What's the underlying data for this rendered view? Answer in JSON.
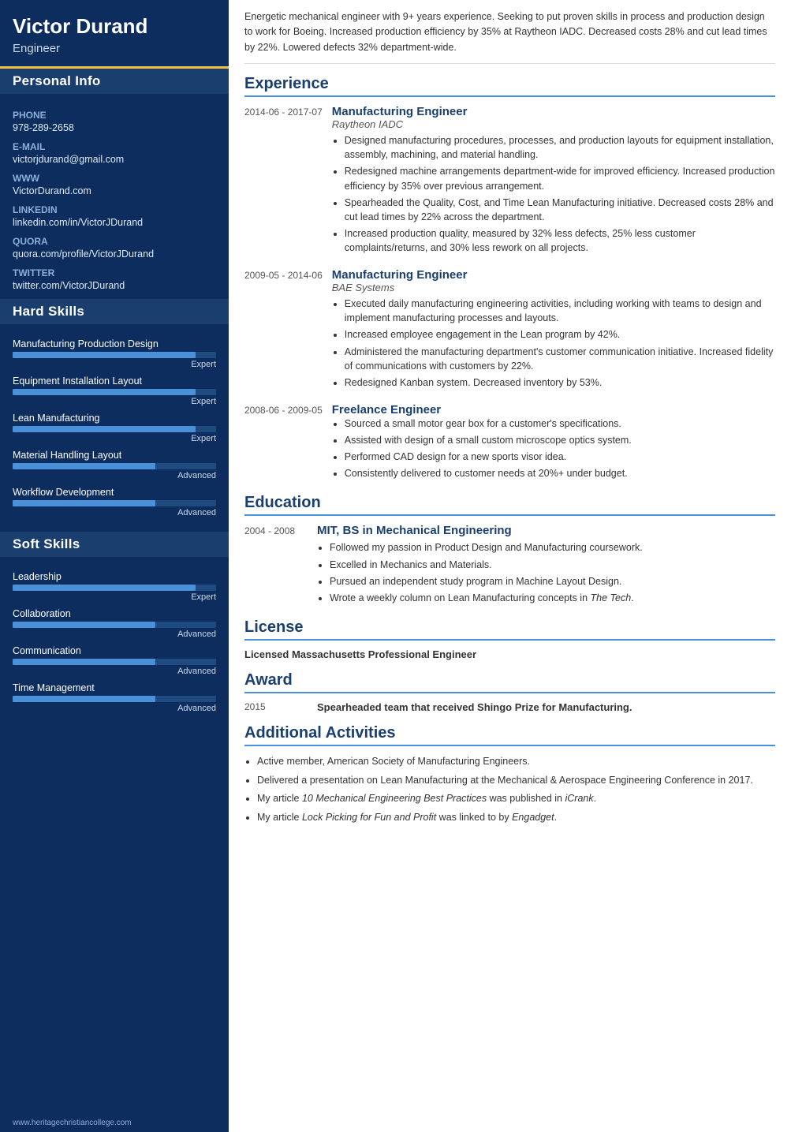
{
  "sidebar": {
    "name": "Victor Durand",
    "title": "Engineer",
    "personal_info_title": "Personal Info",
    "contact": [
      {
        "label": "Phone",
        "value": "978-289-2658"
      },
      {
        "label": "E-mail",
        "value": "victorjdurand@gmail.com"
      },
      {
        "label": "WWW",
        "value": "VictorDurand.com"
      },
      {
        "label": "LinkedIn",
        "value": "linkedin.com/in/VictorJDurand"
      },
      {
        "label": "Quora",
        "value": "quora.com/profile/VictorJDurand"
      },
      {
        "label": "Twitter",
        "value": "twitter.com/VictorJDurand"
      }
    ],
    "hard_skills_title": "Hard Skills",
    "hard_skills": [
      {
        "name": "Manufacturing Production Design",
        "pct": 90,
        "level": "Expert"
      },
      {
        "name": "Equipment Installation Layout",
        "pct": 90,
        "level": "Expert"
      },
      {
        "name": "Lean Manufacturing",
        "pct": 90,
        "level": "Expert"
      },
      {
        "name": "Material Handling Layout",
        "pct": 70,
        "level": "Advanced"
      },
      {
        "name": "Workflow Development",
        "pct": 70,
        "level": "Advanced"
      }
    ],
    "soft_skills_title": "Soft Skills",
    "soft_skills": [
      {
        "name": "Leadership",
        "pct": 90,
        "level": "Expert"
      },
      {
        "name": "Collaboration",
        "pct": 70,
        "level": "Advanced"
      },
      {
        "name": "Communication",
        "pct": 70,
        "level": "Advanced"
      },
      {
        "name": "Time Management",
        "pct": 70,
        "level": "Advanced"
      }
    ],
    "watermark": "www.heritagechristiancollege.com"
  },
  "main": {
    "summary": "Energetic mechanical engineer with 9+ years experience. Seeking to put proven skills in process and production design to work for Boeing. Increased production efficiency by 35% at Raytheon IADC. Decreased costs 28% and cut lead times by 22%. Lowered defects 32% department-wide.",
    "experience_title": "Experience",
    "experience": [
      {
        "date": "2014-06 - 2017-07",
        "title": "Manufacturing Engineer",
        "company": "Raytheon IADC",
        "bullets": [
          "Designed manufacturing procedures, processes, and production layouts for equipment installation, assembly, machining, and material handling.",
          "Redesigned machine arrangements department-wide for improved efficiency. Increased production efficiency by 35% over previous arrangement.",
          "Spearheaded the Quality, Cost, and Time Lean Manufacturing initiative. Decreased costs 28% and cut lead times by 22% across the department.",
          "Increased production quality, measured by 32% less defects, 25% less customer complaints/returns, and 30% less rework on all projects."
        ]
      },
      {
        "date": "2009-05 - 2014-06",
        "title": "Manufacturing Engineer",
        "company": "BAE Systems",
        "bullets": [
          "Executed daily manufacturing engineering activities, including working with teams to design and implement manufacturing processes and layouts.",
          "Increased employee engagement in the Lean program by 42%.",
          "Administered the manufacturing department's customer communication initiative. Increased fidelity of communications with customers by 22%.",
          "Redesigned Kanban system. Decreased inventory by 53%."
        ]
      },
      {
        "date": "2008-06 - 2009-05",
        "title": "Freelance Engineer",
        "company": "",
        "bullets": [
          "Sourced a small motor gear box for a customer's specifications.",
          "Assisted with design of a small custom microscope optics system.",
          "Performed CAD design for a new sports visor idea.",
          "Consistently delivered to customer needs at 20%+ under budget."
        ]
      }
    ],
    "education_title": "Education",
    "education": [
      {
        "date": "2004 - 2008",
        "degree": "MIT, BS in Mechanical Engineering",
        "bullets": [
          "Followed my passion in Product Design and Manufacturing coursework.",
          "Excelled in Mechanics and Materials.",
          "Pursued an independent study program in Machine Layout Design.",
          "Wrote a weekly column on Lean Manufacturing concepts in The Tech."
        ]
      }
    ],
    "license_title": "License",
    "license_text": "Licensed Massachusetts Professional Engineer",
    "award_title": "Award",
    "award_year": "2015",
    "award_text": "Spearheaded team that received Shingo Prize for Manufacturing.",
    "activities_title": "Additional Activities",
    "activities": [
      "Active member, American Society of Manufacturing Engineers.",
      "Delivered a presentation on Lean Manufacturing at the Mechanical & Aerospace Engineering Conference in 2017.",
      "My article 10 Mechanical Engineering Best Practices was published in iCrank.",
      "My article Lock Picking for Fun and Profit was linked to by Engadget."
    ]
  }
}
